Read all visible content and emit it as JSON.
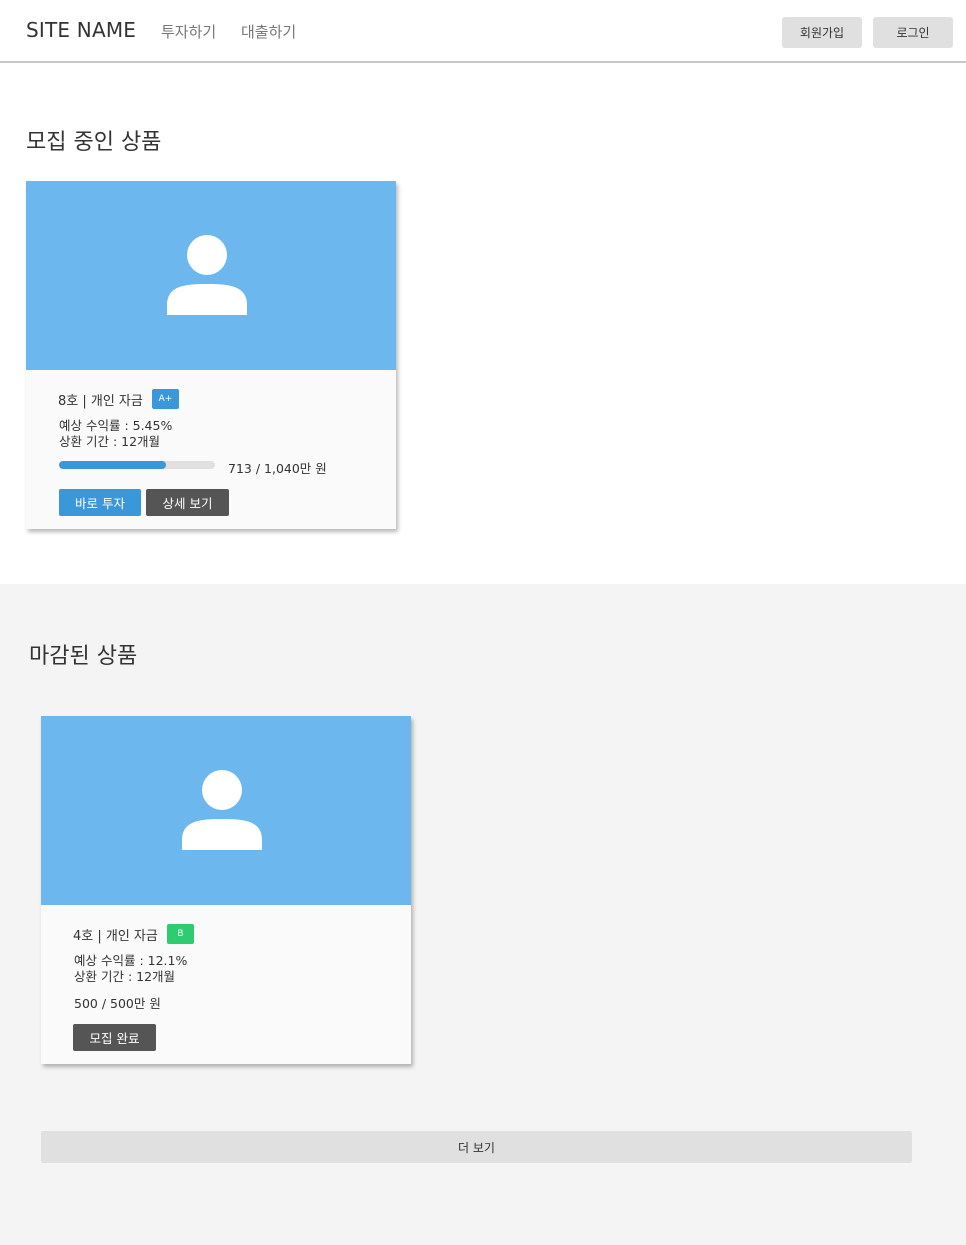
{
  "header": {
    "site_name": "SITE NAME",
    "nav": [
      "투자하기",
      "대출하기"
    ],
    "signup_label": "회원가입",
    "login_label": "로그인"
  },
  "sections": {
    "open_title": "모집 중인 상품",
    "closed_title": "마감된 상품"
  },
  "open_products": [
    {
      "title": "8호 | 개인 자금",
      "grade": "A+",
      "grade_color": "#3a97d9",
      "rate_text": "예상 수익률 : 5.45%",
      "term_text": "상환 기간 : 12개월",
      "progress_text": "713 / 1,040만 원",
      "progress_fraction": 0.686,
      "invest_label": "바로 투자",
      "detail_label": "상세 보기",
      "image_icon": "user-avatar-icon"
    }
  ],
  "closed_products": [
    {
      "title": "4호 | 개인 자금",
      "grade": "B",
      "grade_color": "#2ecc71",
      "rate_text": "예상 수익률 : 12.1%",
      "term_text": "상환 기간 : 12개월",
      "amount_text": "500 / 500만 원",
      "status_label": "모집 완료",
      "image_icon": "user-avatar-icon"
    }
  ],
  "more_label": "더 보기",
  "colors": {
    "accent": "#3a97d9",
    "image_bg": "#6cb8ee",
    "dark_button": "#555555",
    "grade_b": "#2ecc71"
  }
}
